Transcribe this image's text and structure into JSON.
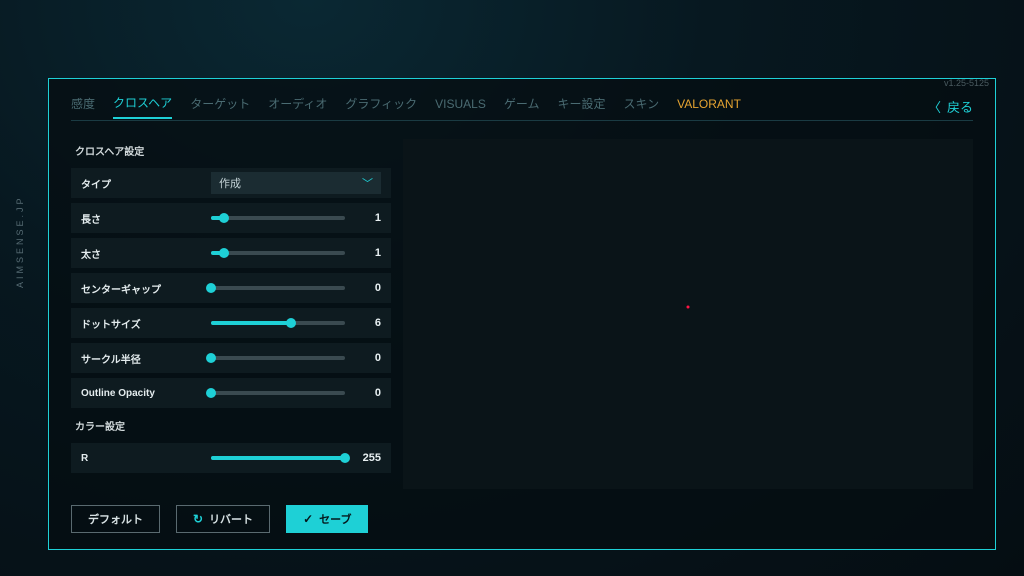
{
  "watermark": "AIMSENSE.JP",
  "version": "v1.25-5125",
  "back_label": "戻る",
  "tabs": [
    {
      "label": "感度",
      "state": "muted"
    },
    {
      "label": "クロスヘア",
      "state": "active"
    },
    {
      "label": "ターゲット",
      "state": "muted"
    },
    {
      "label": "オーディオ",
      "state": "muted"
    },
    {
      "label": "グラフィック",
      "state": "muted"
    },
    {
      "label": "VISUALS",
      "state": "muted"
    },
    {
      "label": "ゲーム",
      "state": "muted"
    },
    {
      "label": "キー設定",
      "state": "muted"
    },
    {
      "label": "スキン",
      "state": "muted"
    },
    {
      "label": "VALORANT",
      "state": "highlight"
    }
  ],
  "section1_title": "クロスヘア設定",
  "type_label": "タイプ",
  "type_value": "作成",
  "sliders": [
    {
      "label": "長さ",
      "value": 1,
      "min": 0,
      "max": 10
    },
    {
      "label": "太さ",
      "value": 1,
      "min": 0,
      "max": 10
    },
    {
      "label": "センターギャップ",
      "value": 0,
      "min": 0,
      "max": 10
    },
    {
      "label": "ドットサイズ",
      "value": 6,
      "min": 0,
      "max": 10
    },
    {
      "label": "サークル半径",
      "value": 0,
      "min": 0,
      "max": 10
    },
    {
      "label": "Outline Opacity",
      "value": 0,
      "min": 0,
      "max": 10
    }
  ],
  "section2_title": "カラー設定",
  "color_sliders": [
    {
      "label": "R",
      "value": 255,
      "min": 0,
      "max": 255
    }
  ],
  "buttons": {
    "default": "デフォルト",
    "revert": "リバート",
    "save": "セーブ"
  },
  "crosshair_preview": {
    "color": "#ff1444"
  }
}
